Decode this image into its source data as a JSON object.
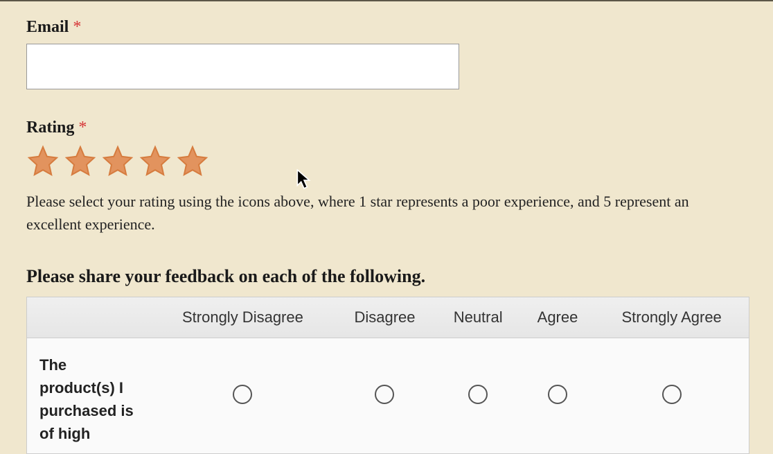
{
  "email": {
    "label": "Email",
    "required_marker": "*",
    "value": ""
  },
  "rating": {
    "label": "Rating",
    "required_marker": "*",
    "star_count": 5,
    "description": "Please select your rating using the icons above, where 1 star represents a poor experience, and 5 represent an excellent experience."
  },
  "feedback": {
    "heading": "Please share your feedback on each of the following.",
    "columns": [
      "Strongly Disagree",
      "Disagree",
      "Neutral",
      "Agree",
      "Strongly Agree"
    ],
    "rows": [
      {
        "label": "The product(s) I purchased is of high"
      }
    ]
  },
  "colors": {
    "background": "#f0e7ce",
    "star_fill": "#e2935e",
    "required": "#d63638"
  }
}
